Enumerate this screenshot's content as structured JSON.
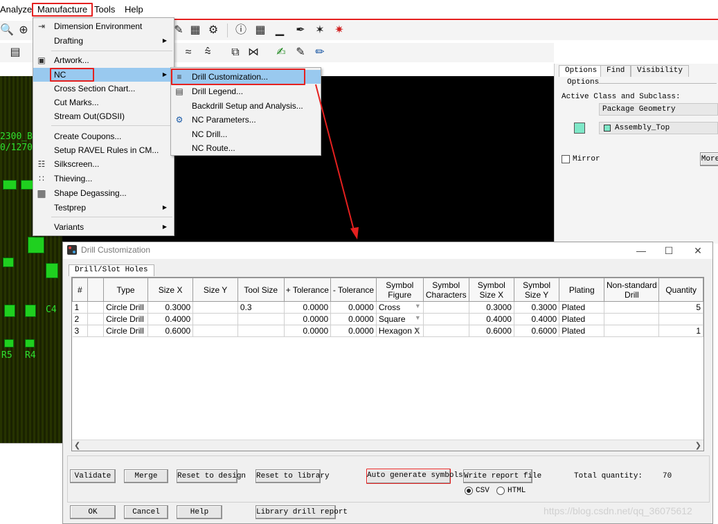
{
  "menubar": {
    "items": [
      "Analyze",
      "Manufacture",
      "Tools",
      "Help"
    ]
  },
  "manufacture_menu": {
    "items": [
      {
        "label": "Dimension Environment",
        "icon": "dimension-icon"
      },
      {
        "label": "Drafting",
        "submenu": true
      },
      {
        "label": "Artwork...",
        "icon": "artwork-icon"
      },
      {
        "label": "NC",
        "submenu": true
      },
      {
        "label": "Cross Section Chart..."
      },
      {
        "label": "Cut Marks..."
      },
      {
        "label": "Stream Out(GDSII)"
      },
      {
        "label": "Create Coupons..."
      },
      {
        "label": "Setup RAVEL Rules in CM..."
      },
      {
        "label": "Silkscreen...",
        "icon": "silkscreen-icon"
      },
      {
        "label": "Thieving...",
        "icon": "thieving-icon"
      },
      {
        "label": "Shape Degassing...",
        "icon": "degassing-icon"
      },
      {
        "label": "Testprep",
        "submenu": true
      },
      {
        "label": "Variants",
        "submenu": true
      }
    ]
  },
  "nc_submenu": {
    "items": [
      {
        "label": "Drill Customization...",
        "icon": "drill-customization-icon"
      },
      {
        "label": "Drill Legend...",
        "icon": "drill-legend-icon"
      },
      {
        "label": "Backdrill Setup and Analysis..."
      },
      {
        "label": "NC Parameters...",
        "icon": "nc-parameters-icon"
      },
      {
        "label": "NC Drill..."
      },
      {
        "label": "NC Route..."
      }
    ]
  },
  "pcb": {
    "text1": "2300_B",
    "text2": "0/1270",
    "text3": "C4",
    "text4": "R5",
    "text5": "R4"
  },
  "options_panel": {
    "tabs": [
      "Options",
      "Find",
      "Visibility"
    ],
    "group_label": "Options",
    "class_label": "Active Class and Subclass:",
    "class_value": "Package Geometry",
    "subclass_value": "Assembly_Top",
    "mirror_label": "Mirror",
    "more_label": "More",
    "swatch_color": "#7fe8c8"
  },
  "dialog": {
    "title": "Drill Customization",
    "tab": "Drill/Slot Holes",
    "columns": [
      "#",
      "",
      "Type",
      "Size X",
      "Size Y",
      "Tool Size",
      "+ Tolerance",
      "- Tolerance",
      "Symbol Figure",
      "Symbol Characters",
      "Symbol Size X",
      "Symbol Size Y",
      "Plating",
      "Non-standard Drill",
      "Quantity"
    ],
    "rows": [
      {
        "num": "1",
        "type": "Circle Drill",
        "size_x": "0.3000",
        "size_y": "",
        "tool_size": "0.3",
        "plus_tol": "0.0000",
        "minus_tol": "0.0000",
        "figure": "Cross",
        "chars": "",
        "sym_x": "0.3000",
        "sym_y": "0.3000",
        "plating": "Plated",
        "nonstd": "",
        "qty": "5"
      },
      {
        "num": "2",
        "type": "Circle Drill",
        "size_x": "0.4000",
        "size_y": "",
        "tool_size": "",
        "plus_tol": "0.0000",
        "minus_tol": "0.0000",
        "figure": "Square",
        "chars": "",
        "sym_x": "0.4000",
        "sym_y": "0.4000",
        "plating": "Plated",
        "nonstd": "",
        "qty": ""
      },
      {
        "num": "3",
        "type": "Circle Drill",
        "size_x": "0.6000",
        "size_y": "",
        "tool_size": "",
        "plus_tol": "0.0000",
        "minus_tol": "0.0000",
        "figure": "Hexagon X",
        "chars": "",
        "sym_x": "0.6000",
        "sym_y": "0.6000",
        "plating": "Plated",
        "nonstd": "",
        "qty": "1"
      }
    ],
    "buttons": {
      "validate": "Validate",
      "merge": "Merge",
      "reset_design": "Reset to design",
      "reset_library": "Reset to library",
      "auto_generate": "Auto generate symbols",
      "write_report": "Write report file",
      "ok": "OK",
      "cancel": "Cancel",
      "help": "Help",
      "library_report": "Library drill report"
    },
    "format_csv": "CSV",
    "format_html": "HTML",
    "total_label": "Total quantity:",
    "total_value": "70"
  },
  "watermark": "https://blog.csdn.net/qq_36075612",
  "colors": {
    "highlight_red": "#e5201f",
    "menu_highlight": "#99c9ef",
    "pcb_green": "#1fd01f"
  }
}
